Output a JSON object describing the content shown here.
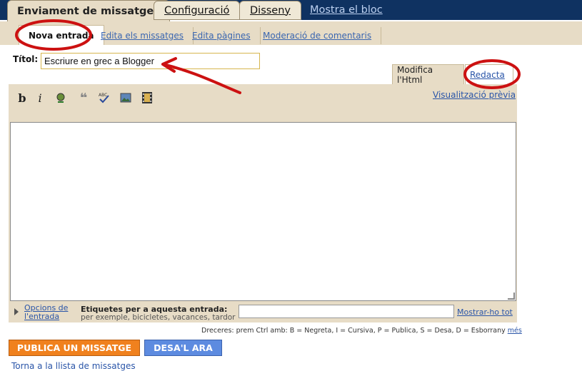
{
  "main_tabs": {
    "posting": "Enviament de missatges",
    "settings": "Configuració",
    "layout": "Disseny",
    "view_blog": "Mostra el bloc"
  },
  "sub_tabs": {
    "new_post": "Nova entrada",
    "edit_posts": "Edita els missatges",
    "edit_pages": "Edita pàgines",
    "moderate": "Moderació de comentaris"
  },
  "editor": {
    "title_label": "Títol:",
    "title_value": "Escriure en grec a Blogger",
    "mode_html": "Modifica l'Html",
    "mode_compose": "Redacta",
    "preview": "Visualització prèvia",
    "toolbar": [
      "bold-icon",
      "italic-icon",
      "font-color-icon",
      "quote-icon",
      "spellcheck-icon",
      "image-icon",
      "video-icon"
    ]
  },
  "labels": {
    "options_link": "Opcions de l'entrada",
    "title": "Etiquetes per a aquesta entrada:",
    "hint": "per exemple, bicicletes, vacances, tardor",
    "show_all": "Mostrar-ho tot"
  },
  "shortcuts": {
    "text": "Dreceres: prem Ctrl amb: B = Negreta, I = Cursiva, P = Publica, S = Desa, D = Esborrany",
    "more": "més"
  },
  "buttons": {
    "publish": "PUBLICA UN MISSATGE",
    "save": "DESA'L ARA"
  },
  "back_link": "Torna a la llista de missatges",
  "colors": {
    "topbar": "#0f3261",
    "panel": "#e7dcc6",
    "publish": "#f0811e",
    "save": "#5d8be0",
    "annotation": "#cc1111"
  }
}
